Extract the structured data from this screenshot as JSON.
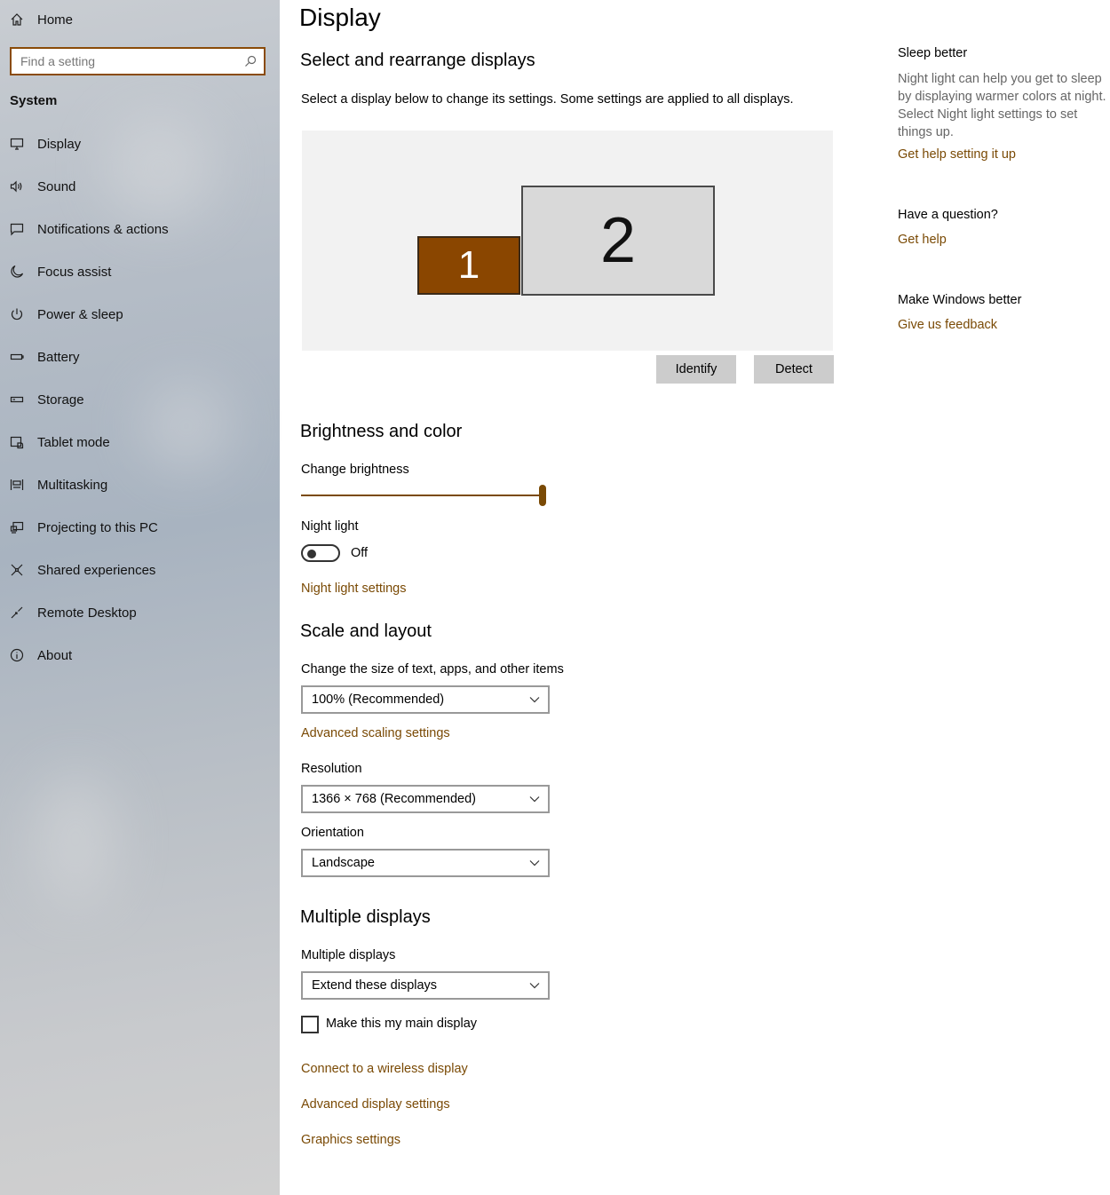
{
  "sidebar": {
    "home_label": "Home",
    "search_placeholder": "Find a setting",
    "section_label": "System",
    "items": [
      {
        "label": "Display",
        "icon": "monitor-icon"
      },
      {
        "label": "Sound",
        "icon": "speaker-icon"
      },
      {
        "label": "Notifications & actions",
        "icon": "notification-icon"
      },
      {
        "label": "Focus assist",
        "icon": "moon-icon"
      },
      {
        "label": "Power & sleep",
        "icon": "power-icon"
      },
      {
        "label": "Battery",
        "icon": "battery-icon"
      },
      {
        "label": "Storage",
        "icon": "storage-icon"
      },
      {
        "label": "Tablet mode",
        "icon": "tablet-icon"
      },
      {
        "label": "Multitasking",
        "icon": "multitasking-icon"
      },
      {
        "label": "Projecting to this PC",
        "icon": "projecting-icon"
      },
      {
        "label": "Shared experiences",
        "icon": "shared-icon"
      },
      {
        "label": "Remote Desktop",
        "icon": "remote-desktop-icon"
      },
      {
        "label": "About",
        "icon": "info-icon"
      }
    ]
  },
  "main": {
    "title": "Display",
    "arrange": {
      "heading": "Select and rearrange displays",
      "description": "Select a display below to change its settings. Some settings are applied to all displays.",
      "display1_label": "1",
      "display2_label": "2",
      "identify_label": "Identify",
      "detect_label": "Detect"
    },
    "brightness": {
      "heading": "Brightness and color",
      "label": "Change brightness",
      "value": 1.0,
      "night_light_label": "Night light",
      "night_light_state": "Off",
      "night_light_settings_link": "Night light settings"
    },
    "scale": {
      "heading": "Scale and layout",
      "size_label": "Change the size of text, apps, and other items",
      "size_value": "100% (Recommended)",
      "advanced_scaling_link": "Advanced scaling settings",
      "resolution_label": "Resolution",
      "resolution_value": "1366 × 768 (Recommended)",
      "orientation_label": "Orientation",
      "orientation_value": "Landscape"
    },
    "multiple": {
      "heading": "Multiple displays",
      "label": "Multiple displays",
      "value": "Extend these displays",
      "main_display_label": "Make this my main display",
      "wireless_link": "Connect to a wireless display",
      "advanced_display_link": "Advanced display settings",
      "graphics_link": "Graphics settings"
    }
  },
  "right": {
    "sleep_heading": "Sleep better",
    "sleep_text": "Night light can help you get to sleep by displaying warmer colors at night. Select Night light settings to set things up.",
    "sleep_link": "Get help setting it up",
    "question_heading": "Have a question?",
    "question_link": "Get help",
    "feedback_heading": "Make Windows better",
    "feedback_link": "Give us feedback"
  },
  "colors": {
    "accent": "#7a4a05",
    "selected_display": "#8a4600"
  }
}
